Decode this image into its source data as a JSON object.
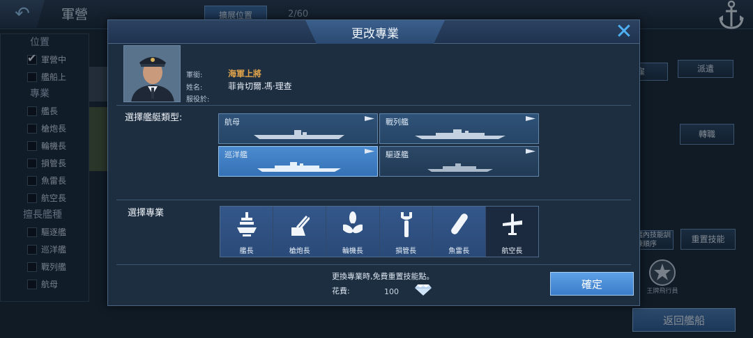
{
  "topbar": {
    "back_icon": "back-arrow-icon",
    "title": "軍營",
    "expand_label": "擴展位置",
    "capacity": "2/60",
    "anchor_icon": "anchor-icon"
  },
  "sidebar": {
    "sections": [
      {
        "header": "位置",
        "items": [
          {
            "label": "軍營中",
            "checked": true
          },
          {
            "label": "艦船上",
            "checked": false
          }
        ]
      },
      {
        "header": "專業",
        "items": [
          {
            "label": "艦長",
            "checked": false
          },
          {
            "label": "槍炮長",
            "checked": false
          },
          {
            "label": "輪機長",
            "checked": false
          },
          {
            "label": "損管長",
            "checked": false
          },
          {
            "label": "魚雷長",
            "checked": false
          },
          {
            "label": "航空長",
            "checked": false
          }
        ]
      },
      {
        "header": "擅長艦種",
        "items": [
          {
            "label": "驅逐艦",
            "checked": false
          },
          {
            "label": "巡洋艦",
            "checked": false
          },
          {
            "label": "戰列艦",
            "checked": false
          },
          {
            "label": "航母",
            "checked": false
          }
        ]
      }
    ]
  },
  "right_panel": {
    "hire_label": "雇",
    "dispatch_label": "派遣",
    "transfer_label": "轉職",
    "skill_order_label": "調整艦內技能訓練順序",
    "reset_skill_label": "重置技能",
    "skill_badge_label": "王牌飛行員",
    "return_label": "返回艦船"
  },
  "modal": {
    "title": "更改專業",
    "close_icon": "close-icon",
    "commander": {
      "rank_label": "軍銜:",
      "rank_value": "海軍上將",
      "name_label": "姓名:",
      "name_value": "菲肯切爾.馮·理查",
      "service_label": "服役於:",
      "service_value": ""
    },
    "ship_type_label": "選擇艦艇類型:",
    "ship_types": [
      {
        "label": "航母",
        "state": "normal"
      },
      {
        "label": "戰列艦",
        "state": "normal"
      },
      {
        "label": "巡洋艦",
        "state": "selected"
      },
      {
        "label": "驅逐艦",
        "state": "dim"
      }
    ],
    "profession_label": "選擇專業",
    "professions": [
      {
        "label": "艦長",
        "icon": "captain-ship-icon",
        "active": false
      },
      {
        "label": "槍炮長",
        "icon": "gun-turret-icon",
        "active": false
      },
      {
        "label": "輪機長",
        "icon": "propeller-icon",
        "active": false
      },
      {
        "label": "損管長",
        "icon": "wrench-icon",
        "active": false
      },
      {
        "label": "魚雷長",
        "icon": "torpedo-icon",
        "active": false
      },
      {
        "label": "航空長",
        "icon": "airplane-icon",
        "active": true
      }
    ],
    "note": "更換專業時,免費重置技能點。",
    "cost_label": "花費:",
    "cost_value": "100",
    "currency_icon": "diamond-icon",
    "confirm_label": "確定"
  },
  "colors": {
    "accent": "#3a7cc8",
    "rank_gold": "#e2a54a",
    "close_blue": "#4fb0f2",
    "panel_bg": "#1e2e41"
  }
}
